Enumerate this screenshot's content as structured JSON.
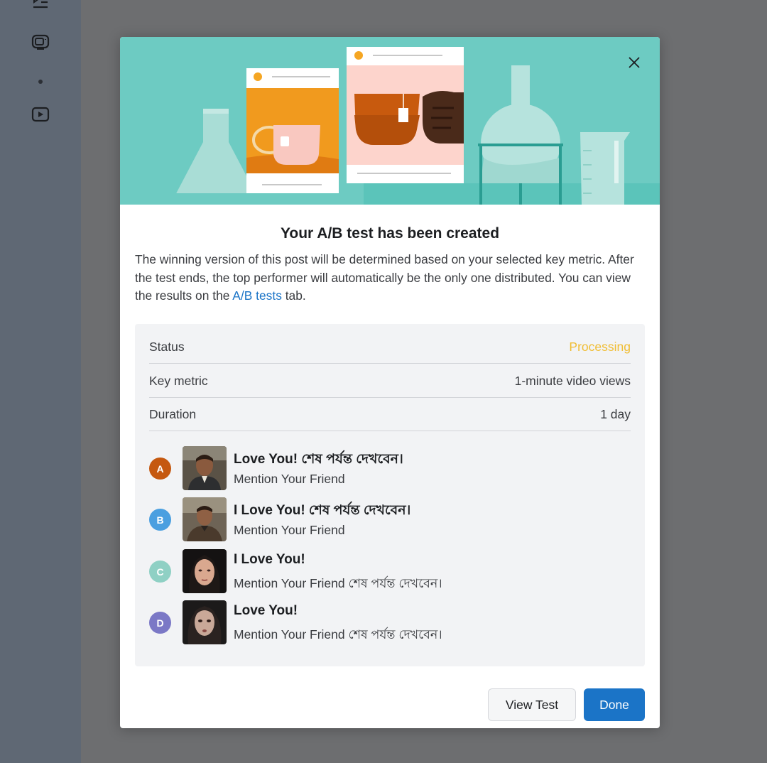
{
  "sidebar": {
    "icons": [
      "playlist-icon",
      "tv-icon",
      "dot",
      "video-play-icon"
    ]
  },
  "modal": {
    "title": "Your A/B test has been created",
    "description_part1": "The winning version of this post will be determined based on your selected key metric. After the test ends, the top performer will automatically be the only one distributed. You can view the results on the ",
    "description_link": "A/B tests",
    "description_part2": " tab.",
    "rows": [
      {
        "label": "Status",
        "value": "Processing",
        "value_color": "#f0bd33"
      },
      {
        "label": "Key metric",
        "value": "1-minute video views"
      },
      {
        "label": "Duration",
        "value": "1 day"
      }
    ],
    "variants": [
      {
        "letter": "A",
        "color": "#c5580f",
        "title": "Love You! শেষ পর্যন্ত দেখবেন।",
        "subtitle": "Mention Your Friend"
      },
      {
        "letter": "B",
        "color": "#4a9fe0",
        "title": "I Love You! শেষ পর্যন্ত দেখবেন।",
        "subtitle": "Mention Your Friend"
      },
      {
        "letter": "C",
        "color": "#8fd0c4",
        "title": "I Love You!",
        "subtitle": "Mention Your Friend শেষ পর্যন্ত দেখবেন।"
      },
      {
        "letter": "D",
        "color": "#7b78c6",
        "title": "Love You!",
        "subtitle": "Mention Your Friend শেষ পর্যন্ত দেখবেন।"
      }
    ],
    "buttons": {
      "view_test": "View Test",
      "done": "Done"
    }
  },
  "colors": {
    "accent": "#1b74c7",
    "hero_bg": "#6dcbc2",
    "processing": "#f0bd33"
  }
}
